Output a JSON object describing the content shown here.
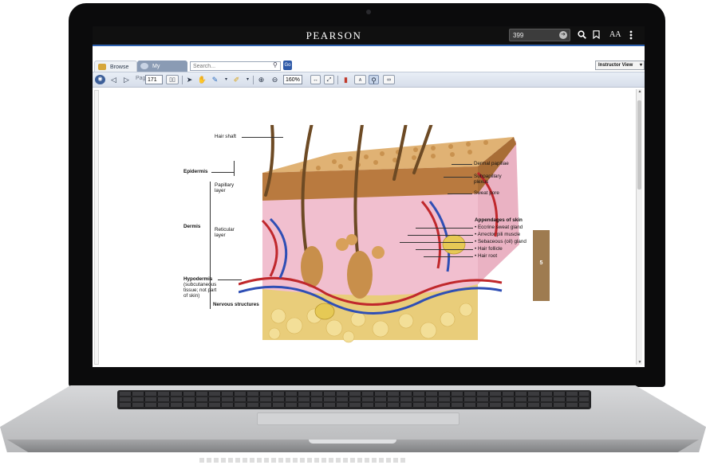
{
  "app": {
    "brand": "PEARSON",
    "page_jump_value": "399",
    "font_size_label": "AA"
  },
  "tabs": {
    "browse_label": "Browse",
    "searches_label": "My Searches",
    "search_placeholder": "Search...",
    "go_label": "Go",
    "view_select_value": "Instructor View"
  },
  "toolbar": {
    "page_label": "Page",
    "page_value": "171",
    "zoom_value": "160%"
  },
  "figure": {
    "labels": {
      "hair_shaft": "Hair shaft",
      "epidermis": "Epidermis",
      "papillary": "Papillary",
      "papillary_2": "layer",
      "dermis": "Dermis",
      "reticular": "Reticular",
      "reticular_2": "layer",
      "hypodermis": "Hypodermis",
      "hypodermis_desc_1": "(subcutaneous",
      "hypodermis_desc_2": "tissue; not part",
      "hypodermis_desc_3": "of skin)",
      "nervous": "Nervous structures",
      "dermal_papillae": "Dermal papillae",
      "subpapillary_1": "Subpapillary",
      "subpapillary_2": "plexus",
      "sweat_pore": "Sweat pore",
      "appendages": "Appendages of skin",
      "eccrine": "• Eccrine sweat gland",
      "arrector": "• Arrector pili muscle",
      "sebaceous": "• Sebaceous (oil) gland",
      "hair_follicle": "• Hair follicle",
      "hair_root": "• Hair root"
    },
    "chapter_number": "5"
  },
  "colors": {
    "accent_blue": "#2f62b0",
    "chapter_tab": "#9e7b50",
    "topbar": "#101010"
  }
}
